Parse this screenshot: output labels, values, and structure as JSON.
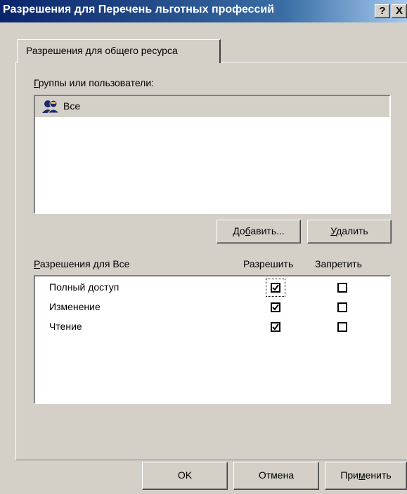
{
  "window": {
    "title": "Разрешения для Перечень льготных профессий",
    "help_label": "?",
    "close_label": "X"
  },
  "tab": {
    "label": "Разрешения для общего ресурса"
  },
  "groups": {
    "label_underlined": "Г",
    "label_rest": "руппы или пользователи:",
    "items": [
      {
        "name": "Все",
        "icon": "users-group-icon",
        "selected": true
      }
    ]
  },
  "buttons": {
    "add_pre": "До",
    "add_u": "б",
    "add_post": "авить...",
    "remove_u": "У",
    "remove_post": "далить",
    "ok": "OK",
    "cancel": "Отмена",
    "apply_pre": "При",
    "apply_u": "м",
    "apply_post": "енить"
  },
  "permissions": {
    "label_underlined": "Р",
    "label_rest": "азрешения для Все",
    "col_allow": "Разрешить",
    "col_deny": "Запретить",
    "rows": [
      {
        "name": "Полный доступ",
        "allow": true,
        "deny": false
      },
      {
        "name": "Изменение",
        "allow": true,
        "deny": false
      },
      {
        "name": "Чтение",
        "allow": true,
        "deny": false
      }
    ]
  }
}
